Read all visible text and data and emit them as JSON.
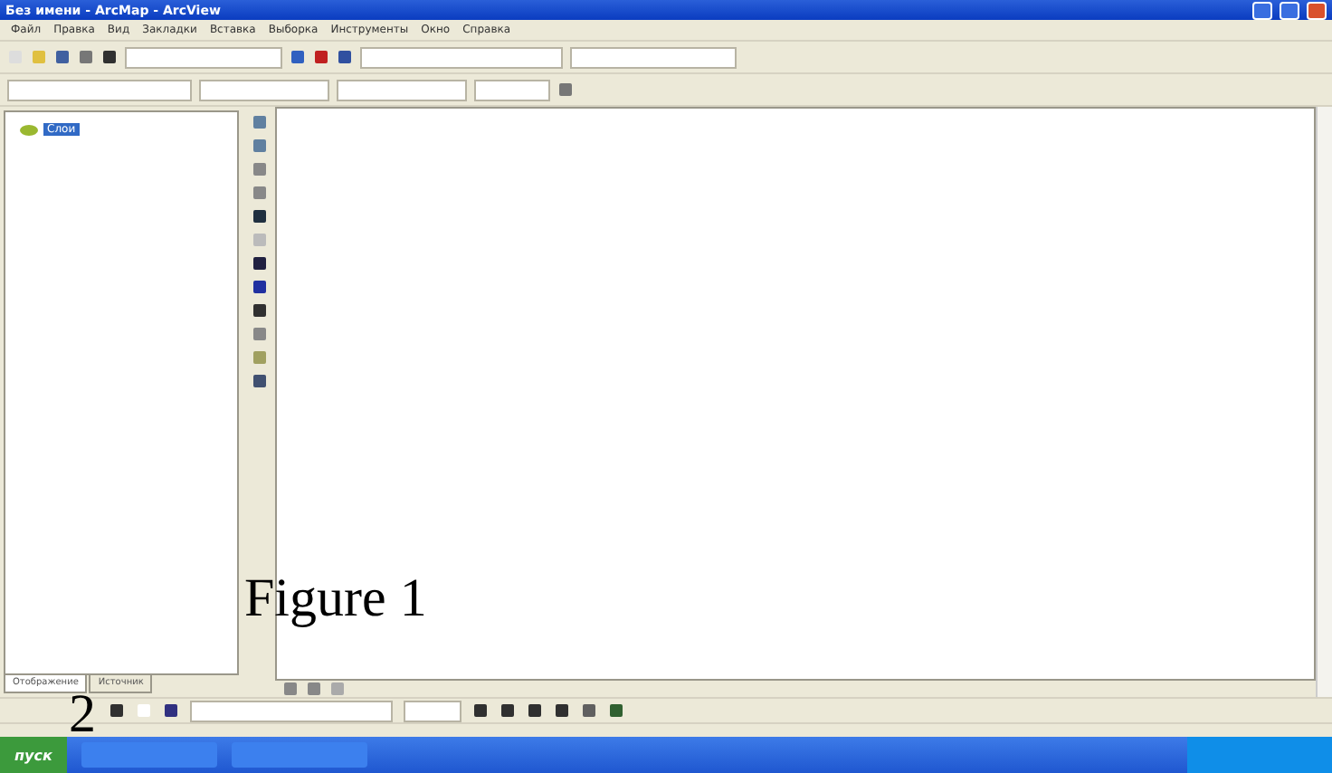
{
  "window": {
    "title": "Без имени - ArcMap - ArcView"
  },
  "menu": [
    "Файл",
    "Правка",
    "Вид",
    "Закладки",
    "Вставка",
    "Выборка",
    "Инструменты",
    "Окно",
    "Справка"
  ],
  "toc": {
    "items": [
      {
        "label": "Слои",
        "selected": true
      }
    ]
  },
  "toc_tabs": [
    {
      "label": "Отображение",
      "selected": true
    },
    {
      "label": "Источник",
      "selected": false
    }
  ],
  "overlay": {
    "caption": "Figure 1",
    "number": "2"
  },
  "taskbar": {
    "start": "пуск"
  }
}
